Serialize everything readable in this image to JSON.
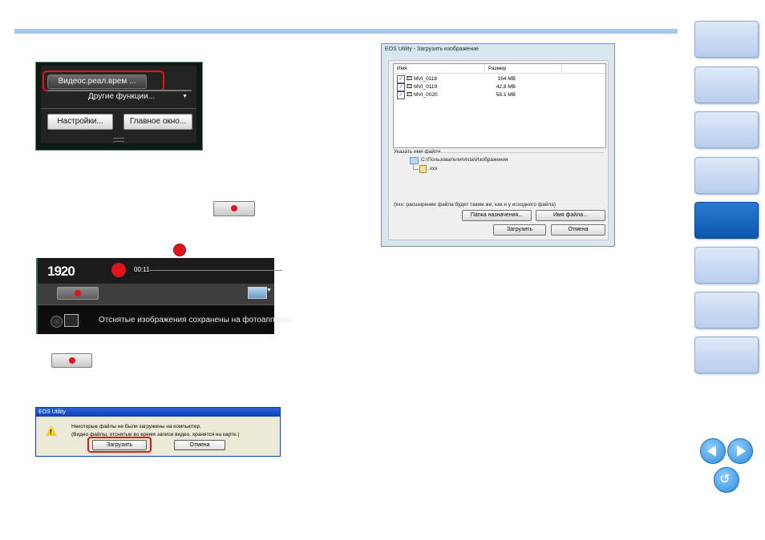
{
  "camera_panel": {
    "live_view_button": "Видеос.реал.врем ...",
    "other_functions_button": "Другие функции...",
    "settings_button": "Настройки...",
    "main_window_button": "Главное окно..."
  },
  "live_view": {
    "resolution_badge": "1920",
    "timer": "00:11",
    "status_message": "Отснятые изображения сохранены на фотоаппарат."
  },
  "xp_dialog": {
    "title": "EOS Utility",
    "message_line1": "Некоторые файлы не были загружены на компьютер.",
    "message_line2": "(Видео файлы, отснятые во время записи видео, хранятся на карте.)",
    "download_button": "Загрузить",
    "cancel_button": "Отмена"
  },
  "download_dialog": {
    "title": "EOS Utility - Загрузить изображение",
    "columns": [
      "Имя",
      "Размер"
    ],
    "files": [
      {
        "name": "MVI_0118",
        "size": "164 MB"
      },
      {
        "name": "MVI_0119",
        "size": "42.8 MB"
      },
      {
        "name": "MVI_0020",
        "size": "58.1 MB"
      }
    ],
    "filename_section_label": "Указать имя файла",
    "folder_path": "C:\\Пользователи\\vista\\Изображения",
    "file_ext": ".xxx",
    "note": "(xxx: расширение файла будет таким же, как и у исходного файла)",
    "destination_button": "Папка назначения...",
    "filename_button": "Имя файла...",
    "download_button": "Загрузить",
    "cancel_button": "Отмена"
  }
}
